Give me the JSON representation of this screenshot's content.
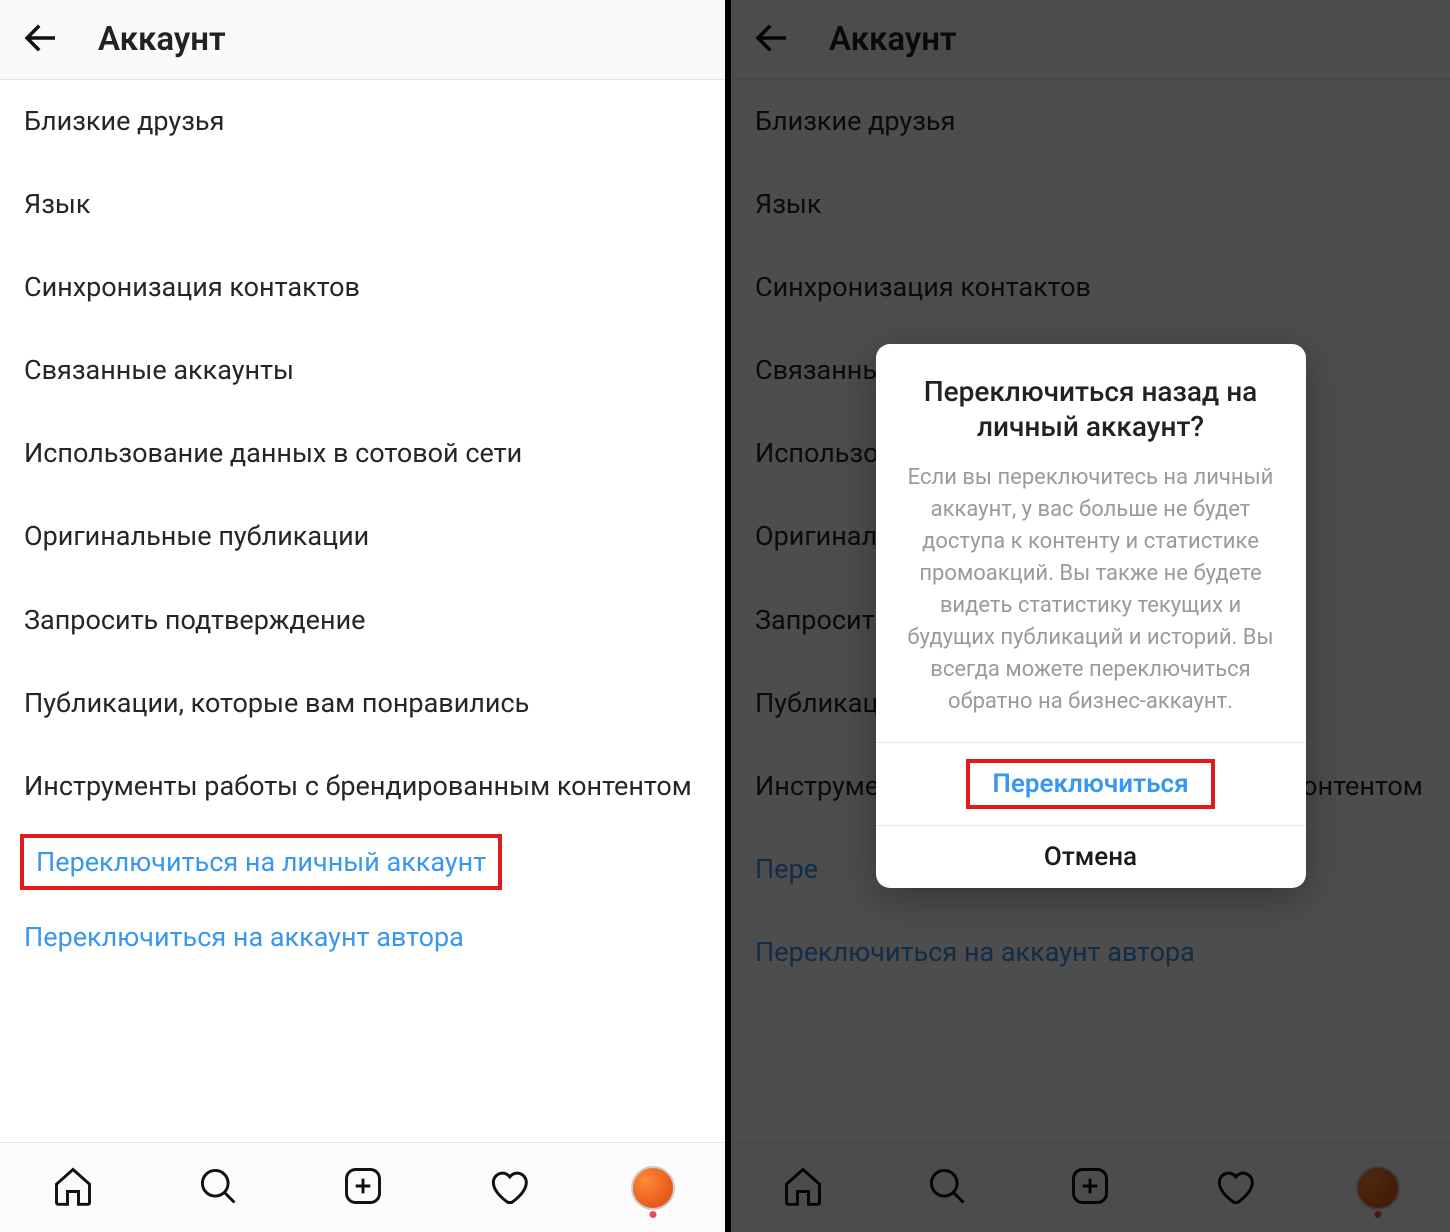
{
  "left": {
    "header_title": "Аккаунт",
    "items": [
      "Близкие друзья",
      "Язык",
      "Синхронизация контактов",
      "Связанные аккаунты",
      "Использование данных в сотовой сети",
      "Оригинальные публикации",
      "Запросить подтверждение",
      "Публикации, которые вам понравились",
      "Инструменты работы с брендированным контентом"
    ],
    "switch_personal": "Переключиться на личный аккаунт",
    "switch_author": "Переключиться на аккаунт автора"
  },
  "right": {
    "header_title": "Аккаунт",
    "items": [
      "Близкие друзья",
      "Язык",
      "Синхронизация контактов",
      "Связанные аккаунты",
      "Использование данных в сотовой сети",
      "Оригинальные публикации",
      "Запросить подтверждение",
      "Публикации, которые вам понравились",
      "Инструменты работы с брендированным контентом"
    ],
    "switch_personal_short": "Пере",
    "switch_author": "Переключиться на аккаунт автора",
    "dialog": {
      "title": "Переключиться назад на личный аккаунт?",
      "body": "Если вы переключитесь на личный аккаунт, у вас больше не будет доступа к контенту и статистике промоакций. Вы также не будете видеть статистику текущих и будущих публикаций и историй. Вы всегда можете переключиться обратно на бизнес-аккаунт.",
      "confirm": "Переключиться",
      "cancel": "Отмена"
    }
  }
}
